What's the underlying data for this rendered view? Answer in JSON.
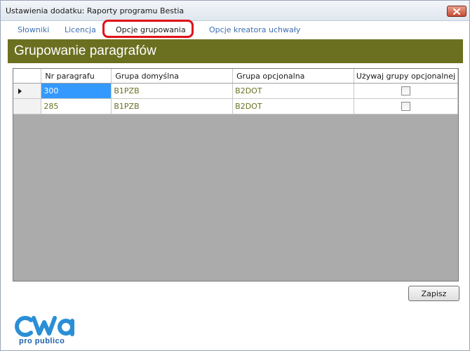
{
  "window": {
    "title": "Ustawienia dodatku: Raporty programu Bestia"
  },
  "tabs": [
    {
      "label": "Słowniki",
      "active": false
    },
    {
      "label": "Licencja",
      "active": false
    },
    {
      "label": "Opcje grupowania",
      "active": true
    },
    {
      "label": "Opcje kreatora uchwały",
      "active": false
    }
  ],
  "section": {
    "title": "Grupowanie paragrafów"
  },
  "grid": {
    "columns": [
      "Nr paragrafu",
      "Grupa domyślna",
      "Grupa opcjonalna",
      "Używaj grupy opcjonalnej"
    ],
    "rows": [
      {
        "nr": "300",
        "default_group": "B1PZB",
        "optional_group": "B2DOT",
        "use_optional": false
      },
      {
        "nr": "285",
        "default_group": "B1PZB",
        "optional_group": "B2DOT",
        "use_optional": false
      }
    ]
  },
  "actions": {
    "save_label": "Zapisz"
  },
  "logo": {
    "subtitle": "pro publico"
  },
  "colors": {
    "header_bg": "#6b7021",
    "tab_link": "#3d6fb0",
    "selection": "#3399ff",
    "highlight": "#e0101a"
  }
}
